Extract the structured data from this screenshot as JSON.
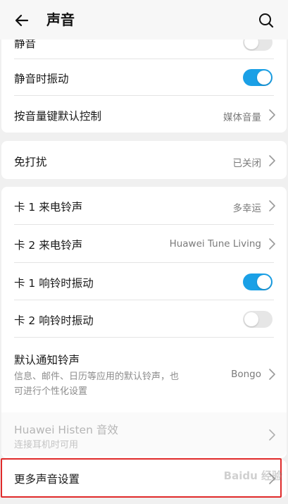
{
  "header": {
    "title": "声音",
    "back_icon": "arrow-left-icon",
    "search_icon": "search-icon"
  },
  "rows": {
    "mute": {
      "label": "静音",
      "toggle": "off"
    },
    "vibrate_when_mute": {
      "label": "静音时振动",
      "toggle": "on"
    },
    "volume_key": {
      "label": "按音量键默认控制",
      "value": "媒体音量"
    },
    "dnd": {
      "label": "免打扰",
      "value": "已关闭"
    },
    "sim1_ringtone": {
      "label": "卡 1 来电铃声",
      "value": "多幸运"
    },
    "sim2_ringtone": {
      "label": "卡 2 来电铃声",
      "value": "Huawei Tune Living"
    },
    "sim1_vibrate": {
      "label": "卡 1 响铃时振动",
      "toggle": "on"
    },
    "sim2_vibrate": {
      "label": "卡 2 响铃时振动",
      "toggle": "off"
    },
    "notification_tone": {
      "label": "默认通知铃声",
      "sub_line1": "信息、邮件、日历等应用的默认铃声，也",
      "sub_line2": "可进行个性化设置",
      "value": "Bongo"
    },
    "histen": {
      "label": "Huawei Histen 音效",
      "sub": "连接耳机时可用",
      "disabled": true
    },
    "more_sound": {
      "label": "更多声音设置"
    }
  },
  "colors": {
    "accent": "#1aa0e6",
    "highlight": "#e02a2a"
  },
  "watermark": "Baidu 经验"
}
